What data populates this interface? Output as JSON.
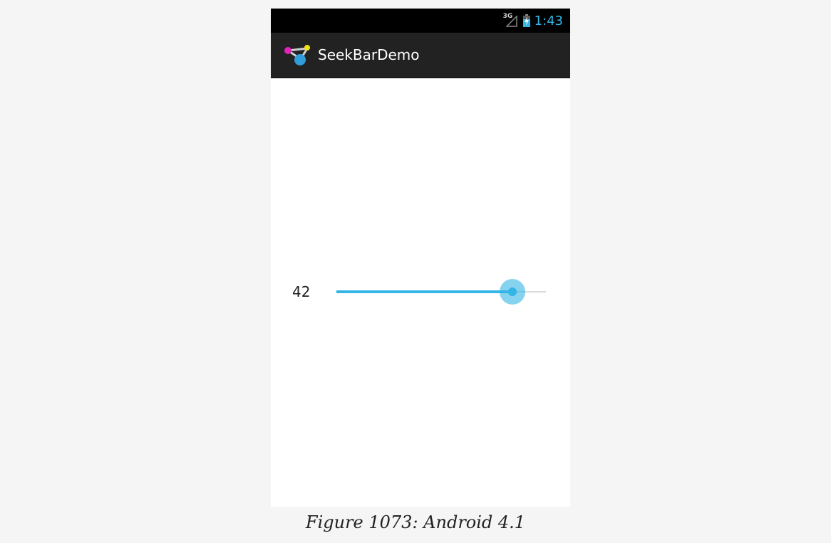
{
  "status_bar": {
    "network_type": "3G",
    "time": "1:43",
    "signal_icon": "cell-signal-icon",
    "battery_icon": "battery-charging-icon",
    "accent_color": "#33b5e5"
  },
  "action_bar": {
    "app_icon": "app-logo-icon",
    "title": "SeekBarDemo"
  },
  "seekbar": {
    "value_label": "42",
    "progress": 42,
    "max": 50,
    "accent_color": "#33b5e5"
  },
  "caption": {
    "text": "Figure 1073: Android 4.1"
  }
}
